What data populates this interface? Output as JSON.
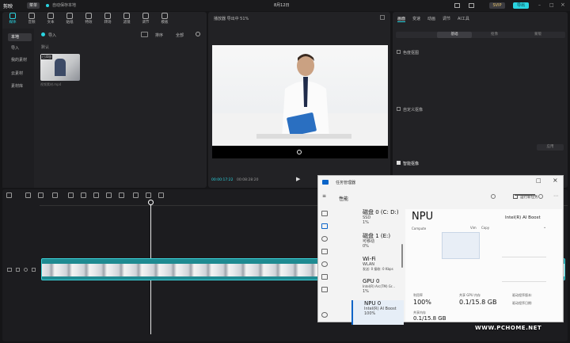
{
  "app": {
    "name": "剪映",
    "menu_label": "菜单",
    "project_label": "自动保存本地",
    "title": "8月12日",
    "btn_pro": "SVIP",
    "btn_export": "导出"
  },
  "toolbar": [
    {
      "label": "媒体"
    },
    {
      "label": "音频"
    },
    {
      "label": "文本"
    },
    {
      "label": "贴纸"
    },
    {
      "label": "特效"
    },
    {
      "label": "转场"
    },
    {
      "label": "滤镜"
    },
    {
      "label": "调节"
    },
    {
      "label": "模板"
    }
  ],
  "sidebar": [
    {
      "label": "本地"
    },
    {
      "label": "导入"
    },
    {
      "label": "我的素材"
    },
    {
      "label": "云素材"
    },
    {
      "label": "素材库"
    }
  ],
  "media": {
    "import_label": "导入",
    "filter1": "排序",
    "filter2": "全部",
    "section": "默认",
    "clip_name": "视频素材.mp4",
    "clip_badge": "已添加"
  },
  "player": {
    "title": "播放器 导出中 51%",
    "time_current": "00:00:17:22",
    "time_total": "00:08:28:20"
  },
  "inspector": {
    "tabs": [
      "画面",
      "变速",
      "动画",
      "调节",
      "AI工具"
    ],
    "subtabs": [
      "基础",
      "抠像",
      "蒙版"
    ],
    "sections": [
      "色度抠图",
      "自定义抠像",
      "智能抠像"
    ],
    "apply": "应用"
  },
  "taskmgr": {
    "title": "任务管理器",
    "header": "性能",
    "run_task": "运行新任务",
    "items": [
      {
        "name": "磁盘 0 (C: D:)",
        "sub1": "SSD",
        "sub2": "1%"
      },
      {
        "name": "磁盘 1 (E:)",
        "sub1": "可移动",
        "sub2": "0%"
      },
      {
        "name": "Wi-Fi",
        "sub1": "WLAN",
        "sub2": "发送: 0 接收: 0 Kbps"
      },
      {
        "name": "GPU 0",
        "sub1": "Intel(R) Arc(TM) Gr...",
        "sub2": "1%"
      },
      {
        "name": "NPU 0",
        "sub1": "Intel(R) AI Boost",
        "sub2": "100%"
      }
    ],
    "detail": {
      "name": "NPU",
      "device": "Intel(R) AI Boost",
      "graph_left": "Compute",
      "graph_mid": "Vim",
      "graph_right": "Copy",
      "util_label": "利用率",
      "util_value": "100%",
      "shared_label": "共享 GPU 内存",
      "shared_value": "0.1/15.8 GB",
      "dedicated_label": "共享内存",
      "dedicated_value": "0.1/15.8 GB",
      "driver_label": "驱动程序版本:",
      "driver_date_label": "驱动程序日期:"
    }
  },
  "watermark": "WWW.PCHOME.NET",
  "colors": {
    "accent": "#2ad4e0",
    "track": "#1e8a91",
    "windows_blue": "#0a64c8"
  }
}
